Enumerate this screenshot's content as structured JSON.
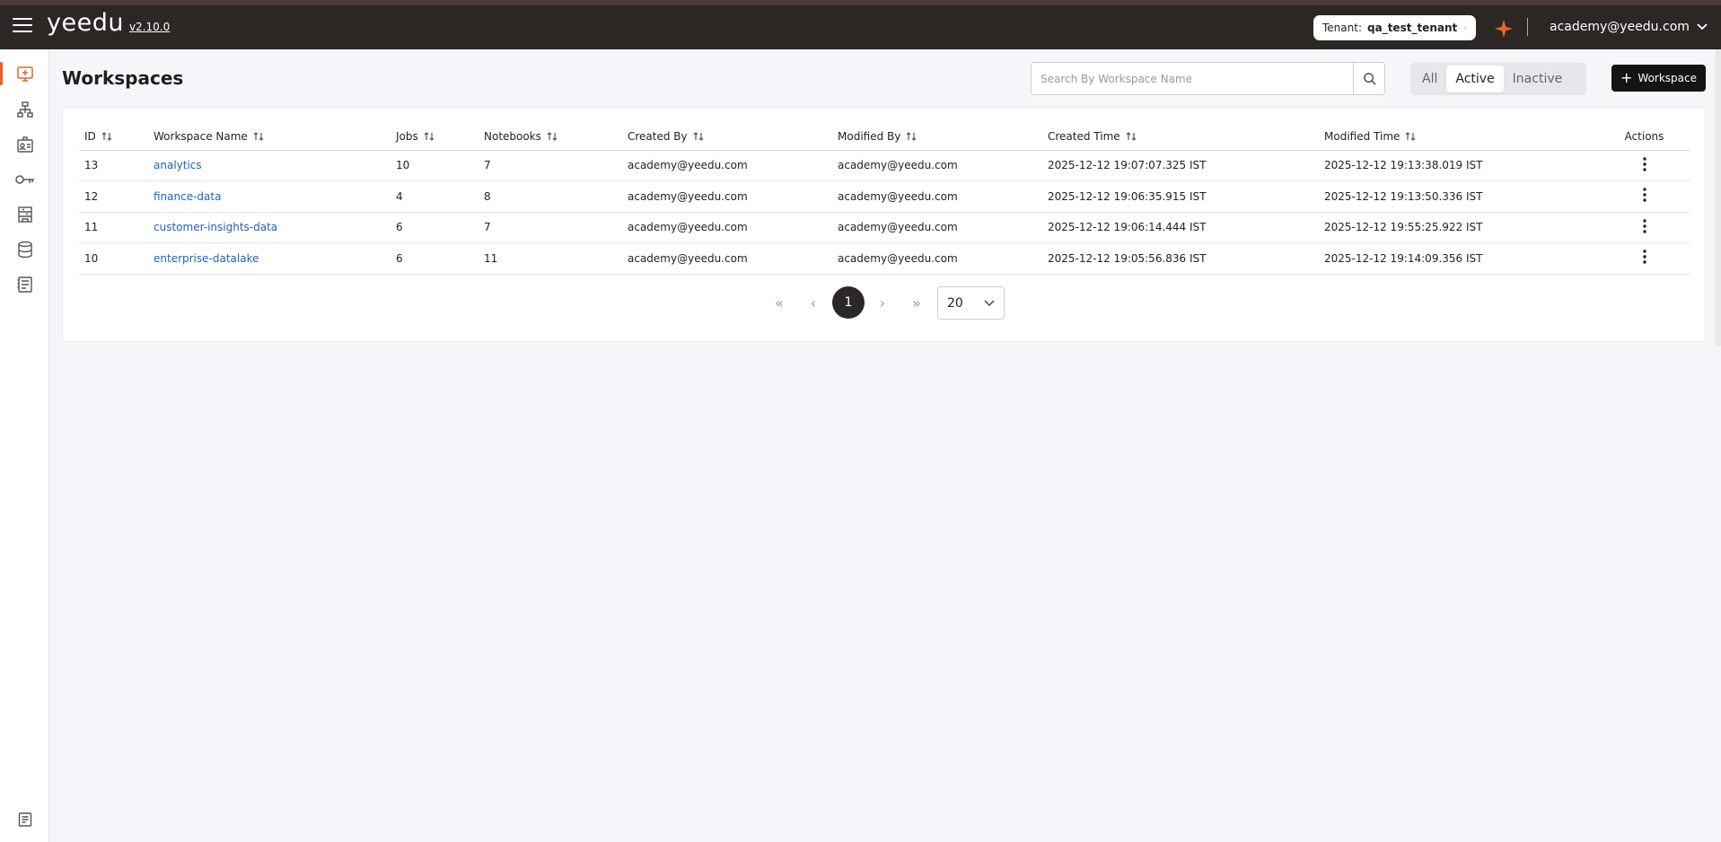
{
  "app": {
    "logo": "yeedu",
    "version": "v2.10.0"
  },
  "header": {
    "tenant_label": "Tenant:",
    "tenant_value": "qa_test_tenant",
    "user": "academy@yeedu.com"
  },
  "sidebar": {
    "items": [
      {
        "icon": "workspaces-icon",
        "active": true
      },
      {
        "icon": "cluster-icon"
      },
      {
        "icon": "id-card-icon"
      },
      {
        "icon": "key-icon"
      },
      {
        "icon": "building-icon"
      },
      {
        "icon": "database-icon"
      },
      {
        "icon": "notebook-icon"
      },
      {
        "icon": "document-icon"
      }
    ]
  },
  "page": {
    "title": "Workspaces",
    "search_placeholder": "Search By Workspace Name",
    "filters": [
      "All",
      "Active",
      "Inactive"
    ],
    "selected_filter": "Active",
    "add_label": "Workspace"
  },
  "table": {
    "columns": [
      "ID",
      "Workspace Name",
      "Jobs",
      "Notebooks",
      "Created By",
      "Modified By",
      "Created Time",
      "Modified Time",
      "Actions"
    ],
    "rows": [
      {
        "id": "13",
        "name": "analytics",
        "jobs": "10",
        "notebooks": "7",
        "created_by": "academy@yeedu.com",
        "modified_by": "academy@yeedu.com",
        "created_time": "2025-12-12 19:07:07.325 IST",
        "modified_time": "2025-12-12 19:13:38.019 IST"
      },
      {
        "id": "12",
        "name": "finance-data",
        "jobs": "4",
        "notebooks": "8",
        "created_by": "academy@yeedu.com",
        "modified_by": "academy@yeedu.com",
        "created_time": "2025-12-12 19:06:35.915 IST",
        "modified_time": "2025-12-12 19:13:50.336 IST"
      },
      {
        "id": "11",
        "name": "customer-insights-data",
        "jobs": "6",
        "notebooks": "7",
        "created_by": "academy@yeedu.com",
        "modified_by": "academy@yeedu.com",
        "created_time": "2025-12-12 19:06:14.444 IST",
        "modified_time": "2025-12-12 19:55:25.922 IST"
      },
      {
        "id": "10",
        "name": "enterprise-datalake",
        "jobs": "6",
        "notebooks": "11",
        "created_by": "academy@yeedu.com",
        "modified_by": "academy@yeedu.com",
        "created_time": "2025-12-12 19:05:56.836 IST",
        "modified_time": "2025-12-12 19:14:09.356 IST"
      }
    ]
  },
  "pagination": {
    "first": "«",
    "prev": "‹",
    "current_page": "1",
    "next": "›",
    "last": "»",
    "page_size": "20"
  },
  "colors": {
    "topbar": "#2b2724",
    "accent": "#e8632b",
    "link": "#1e62c8"
  }
}
